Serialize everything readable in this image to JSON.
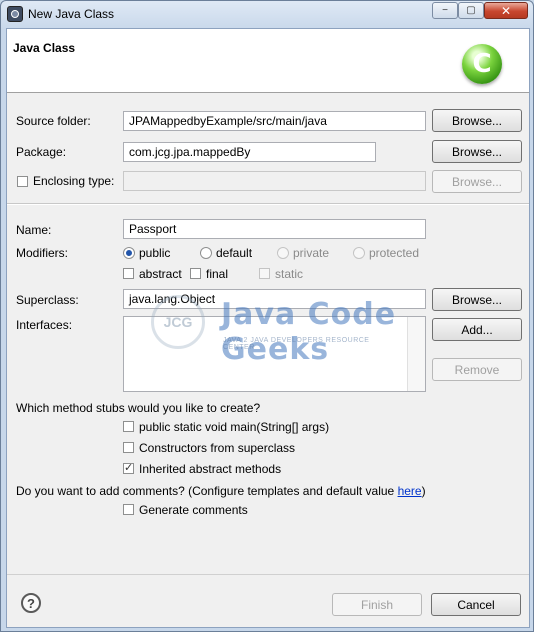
{
  "window": {
    "title": "New Java Class",
    "controls": {
      "minimize": "−",
      "maximize": "▢",
      "close": "✕"
    }
  },
  "header": {
    "title": "Java Class",
    "logo_letter": "C"
  },
  "source_folder": {
    "label": "Source folder:",
    "value": "JPAMappedbyExample/src/main/java",
    "browse": "Browse..."
  },
  "package": {
    "label": "Package:",
    "value": "com.jcg.jpa.mappedBy",
    "browse": "Browse..."
  },
  "enclosing_type": {
    "label": "Enclosing type:",
    "value": "",
    "browse": "Browse..."
  },
  "name": {
    "label": "Name:",
    "value": "Passport"
  },
  "modifiers": {
    "label": "Modifiers:",
    "access": [
      {
        "label": "public",
        "selected": true,
        "enabled": true
      },
      {
        "label": "default",
        "selected": false,
        "enabled": true
      },
      {
        "label": "private",
        "selected": false,
        "enabled": false
      },
      {
        "label": "protected",
        "selected": false,
        "enabled": false
      }
    ],
    "flags": [
      {
        "label": "abstract",
        "checked": false,
        "enabled": true
      },
      {
        "label": "final",
        "checked": false,
        "enabled": true
      },
      {
        "label": "static",
        "checked": false,
        "enabled": false
      }
    ]
  },
  "superclass": {
    "label": "Superclass:",
    "value": "java.lang.Object",
    "browse": "Browse..."
  },
  "interfaces": {
    "label": "Interfaces:",
    "add": "Add...",
    "remove": "Remove"
  },
  "stubs": {
    "question": "Which method stubs would you like to create?",
    "options": [
      {
        "label": "public static void main(String[] args)",
        "checked": false
      },
      {
        "label": "Constructors from superclass",
        "checked": false
      },
      {
        "label": "Inherited abstract methods",
        "checked": true
      }
    ]
  },
  "comments": {
    "question": "Do you want to add comments? (Configure templates and default value ",
    "link": "here",
    "question_end": ")",
    "option": {
      "label": "Generate comments",
      "checked": false
    }
  },
  "watermark": {
    "logo": "JCG",
    "title": "Java Code Geeks",
    "tagline": "JAVA 2 JAVA DEVELOPERS RESOURCE CENTER"
  },
  "footer": {
    "help": "?",
    "finish": "Finish",
    "cancel": "Cancel"
  },
  "check_mark": "✓"
}
